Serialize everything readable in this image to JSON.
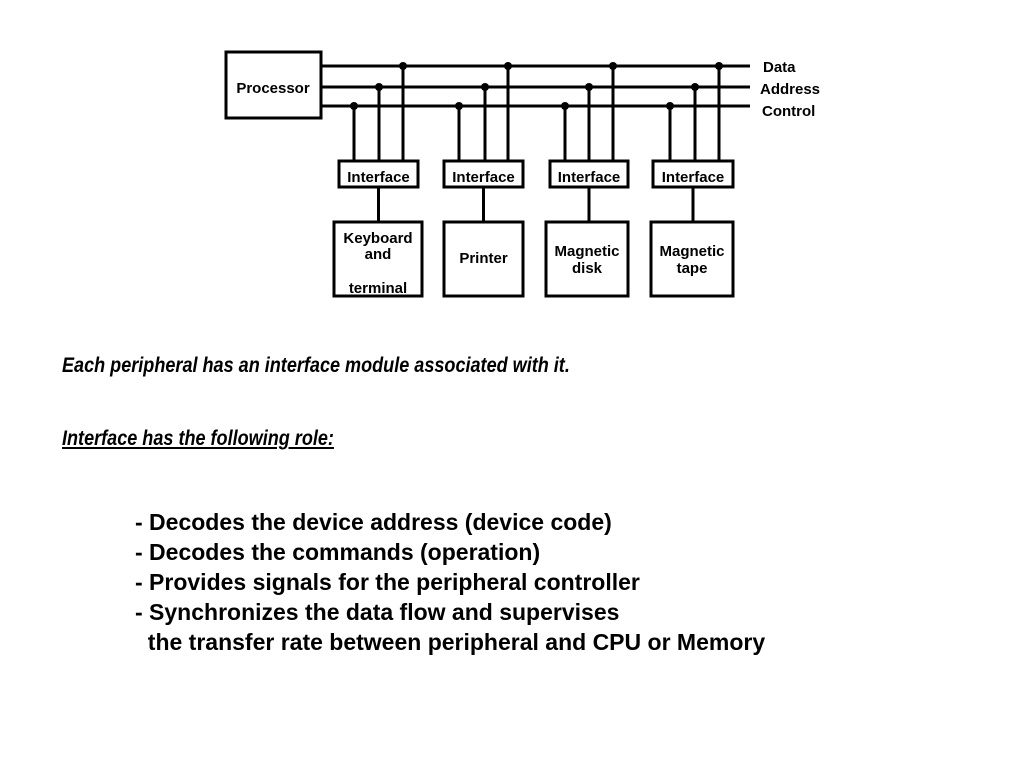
{
  "diagram": {
    "processor": "Processor",
    "buses": [
      "Data",
      "Address",
      "Control"
    ],
    "interface_label": "Interface",
    "devices": [
      {
        "lines": [
          "Keyboard",
          "and",
          "terminal"
        ]
      },
      {
        "lines": [
          "Printer"
        ]
      },
      {
        "lines": [
          "Magnetic",
          "disk"
        ]
      },
      {
        "lines": [
          "Magnetic",
          "tape"
        ]
      }
    ]
  },
  "text": {
    "statement": "Each peripheral has an interface module associated with it.",
    "heading": "Interface has the following role:",
    "roles": [
      "- Decodes the device address (device code)",
      "- Decodes the commands (operation)",
      "- Provides signals for the peripheral controller",
      "- Synchronizes the data flow and supervises",
      "  the transfer rate between peripheral and CPU or Memory"
    ]
  }
}
